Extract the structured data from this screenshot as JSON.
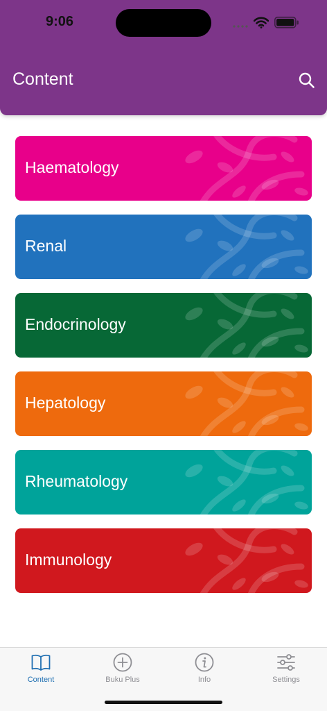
{
  "status_bar": {
    "time": "9:06"
  },
  "header": {
    "title": "Content",
    "background": "#7d3589",
    "search_icon": "search-icon"
  },
  "categories": [
    {
      "label": "Haematology",
      "color": "#e8008a"
    },
    {
      "label": "Renal",
      "color": "#2172bd"
    },
    {
      "label": "Endocrinology",
      "color": "#076836"
    },
    {
      "label": "Hepatology",
      "color": "#ee6a0d"
    },
    {
      "label": "Rheumatology",
      "color": "#00a39a"
    },
    {
      "label": "Immunology",
      "color": "#d0181e"
    }
  ],
  "tabbar": {
    "active_color": "#1f6fb2",
    "items": [
      {
        "label": "Content",
        "icon": "book-icon",
        "active": true
      },
      {
        "label": "Buku Plus",
        "icon": "plus-circle-icon",
        "active": false
      },
      {
        "label": "Info",
        "icon": "info-icon",
        "active": false
      },
      {
        "label": "Settings",
        "icon": "sliders-icon",
        "active": false
      }
    ]
  }
}
